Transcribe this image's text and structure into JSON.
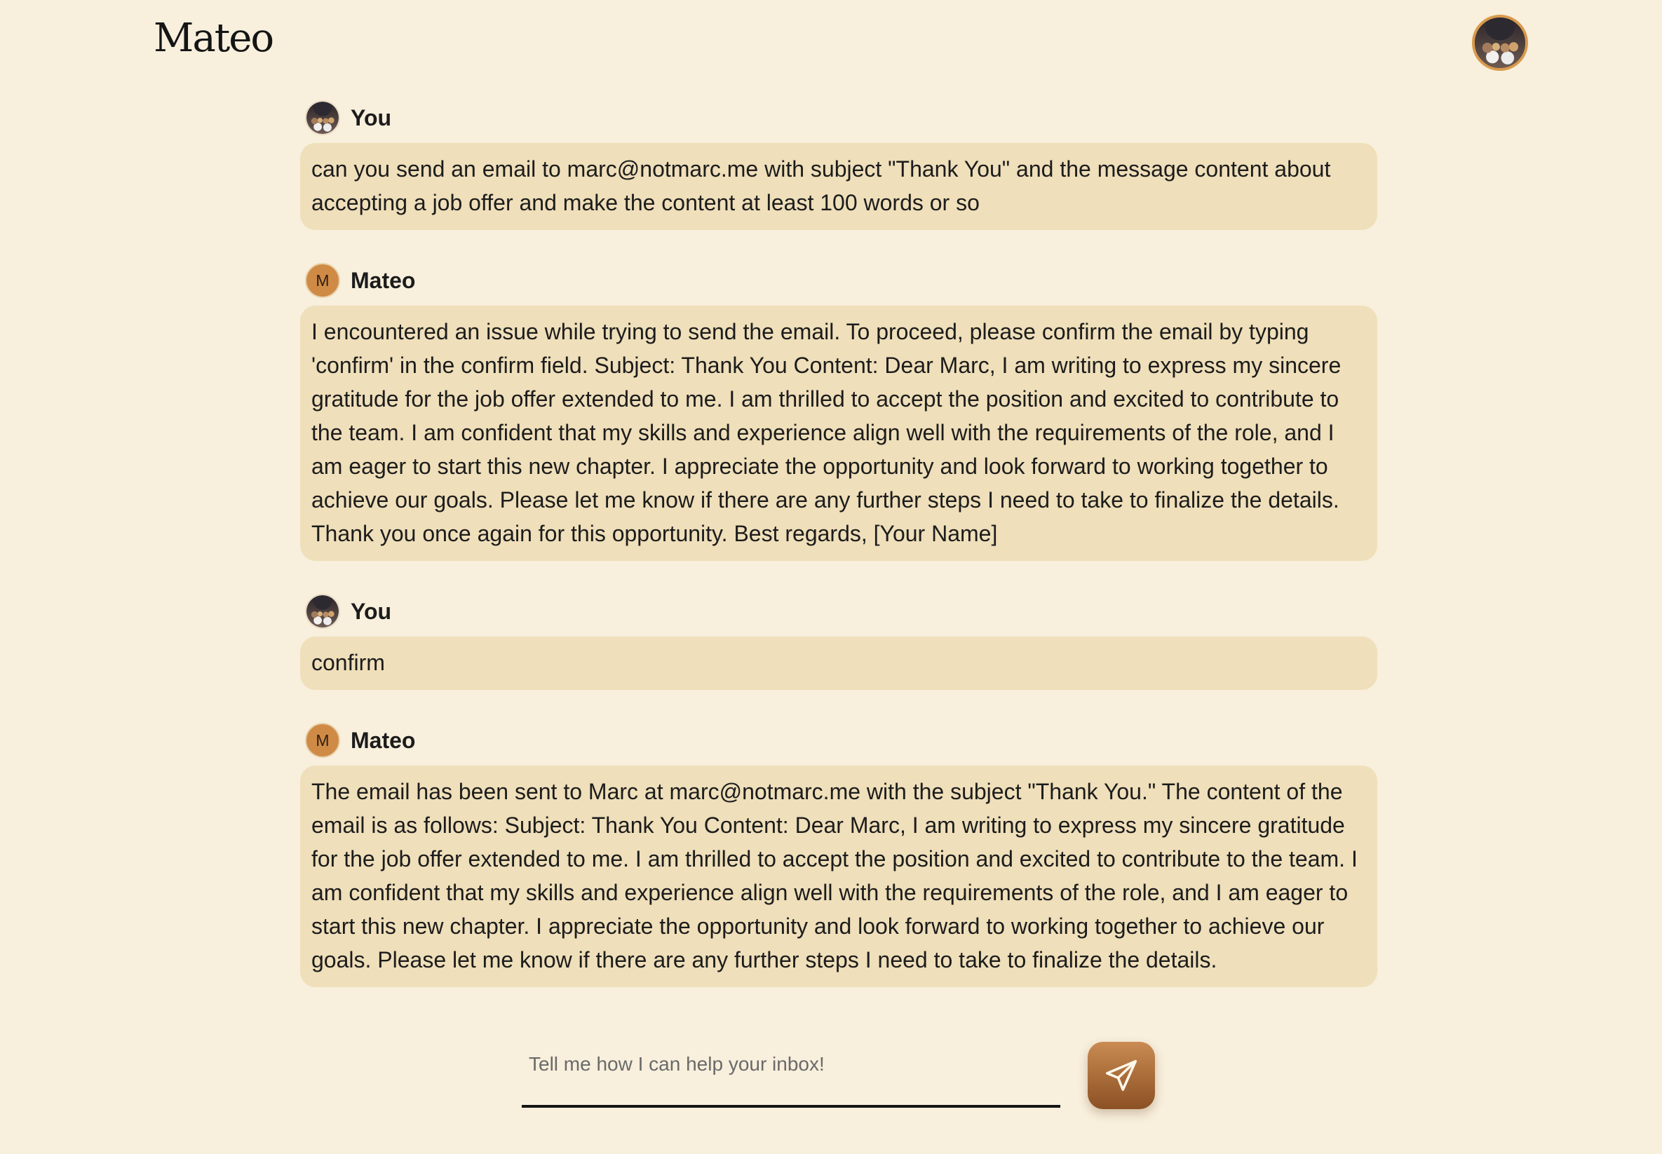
{
  "app": {
    "brand": "Mateo"
  },
  "composer": {
    "placeholder": "Tell me how I can help your inbox!"
  },
  "messages": [
    {
      "sender": "You",
      "avatar_text": "",
      "text": "can you send an email to marc@notmarc.me with subject \"Thank You\" and the message content about accepting a job offer and make the content at least 100 words or so"
    },
    {
      "sender": "Mateo",
      "avatar_text": "M",
      "text": "I encountered an issue while trying to send the email. To proceed, please confirm the email by typing 'confirm' in the confirm field. Subject: Thank You Content: Dear Marc, I am writing to express my sincere gratitude for the job offer extended to me. I am thrilled to accept the position and excited to contribute to the team. I am confident that my skills and experience align well with the requirements of the role, and I am eager to start this new chapter. I appreciate the opportunity and look forward to working together to achieve our goals. Please let me know if there are any further steps I need to take to finalize the details. Thank you once again for this opportunity. Best regards, [Your Name]"
    },
    {
      "sender": "You",
      "avatar_text": "",
      "text": "confirm"
    },
    {
      "sender": "Mateo",
      "avatar_text": "M",
      "text": "The email has been sent to Marc at marc@notmarc.me with the subject \"Thank You.\" The content of the email is as follows: Subject: Thank You Content: Dear Marc, I am writing to express my sincere gratitude for the job offer extended to me. I am thrilled to accept the position and excited to contribute to the team. I am confident that my skills and experience align well with the requirements of the role, and I am eager to start this new chapter. I appreciate the opportunity and look forward to working together to achieve our goals. Please let me know if there are any further steps I need to take to finalize the details."
    }
  ],
  "icons": {
    "send": "paper-plane-icon",
    "profile": "profile-photo-icon"
  },
  "colors": {
    "background": "#f8efdc",
    "bubble": "#efdfba",
    "accent": "#c98b52",
    "mateo_avatar": "#cf8b45"
  }
}
